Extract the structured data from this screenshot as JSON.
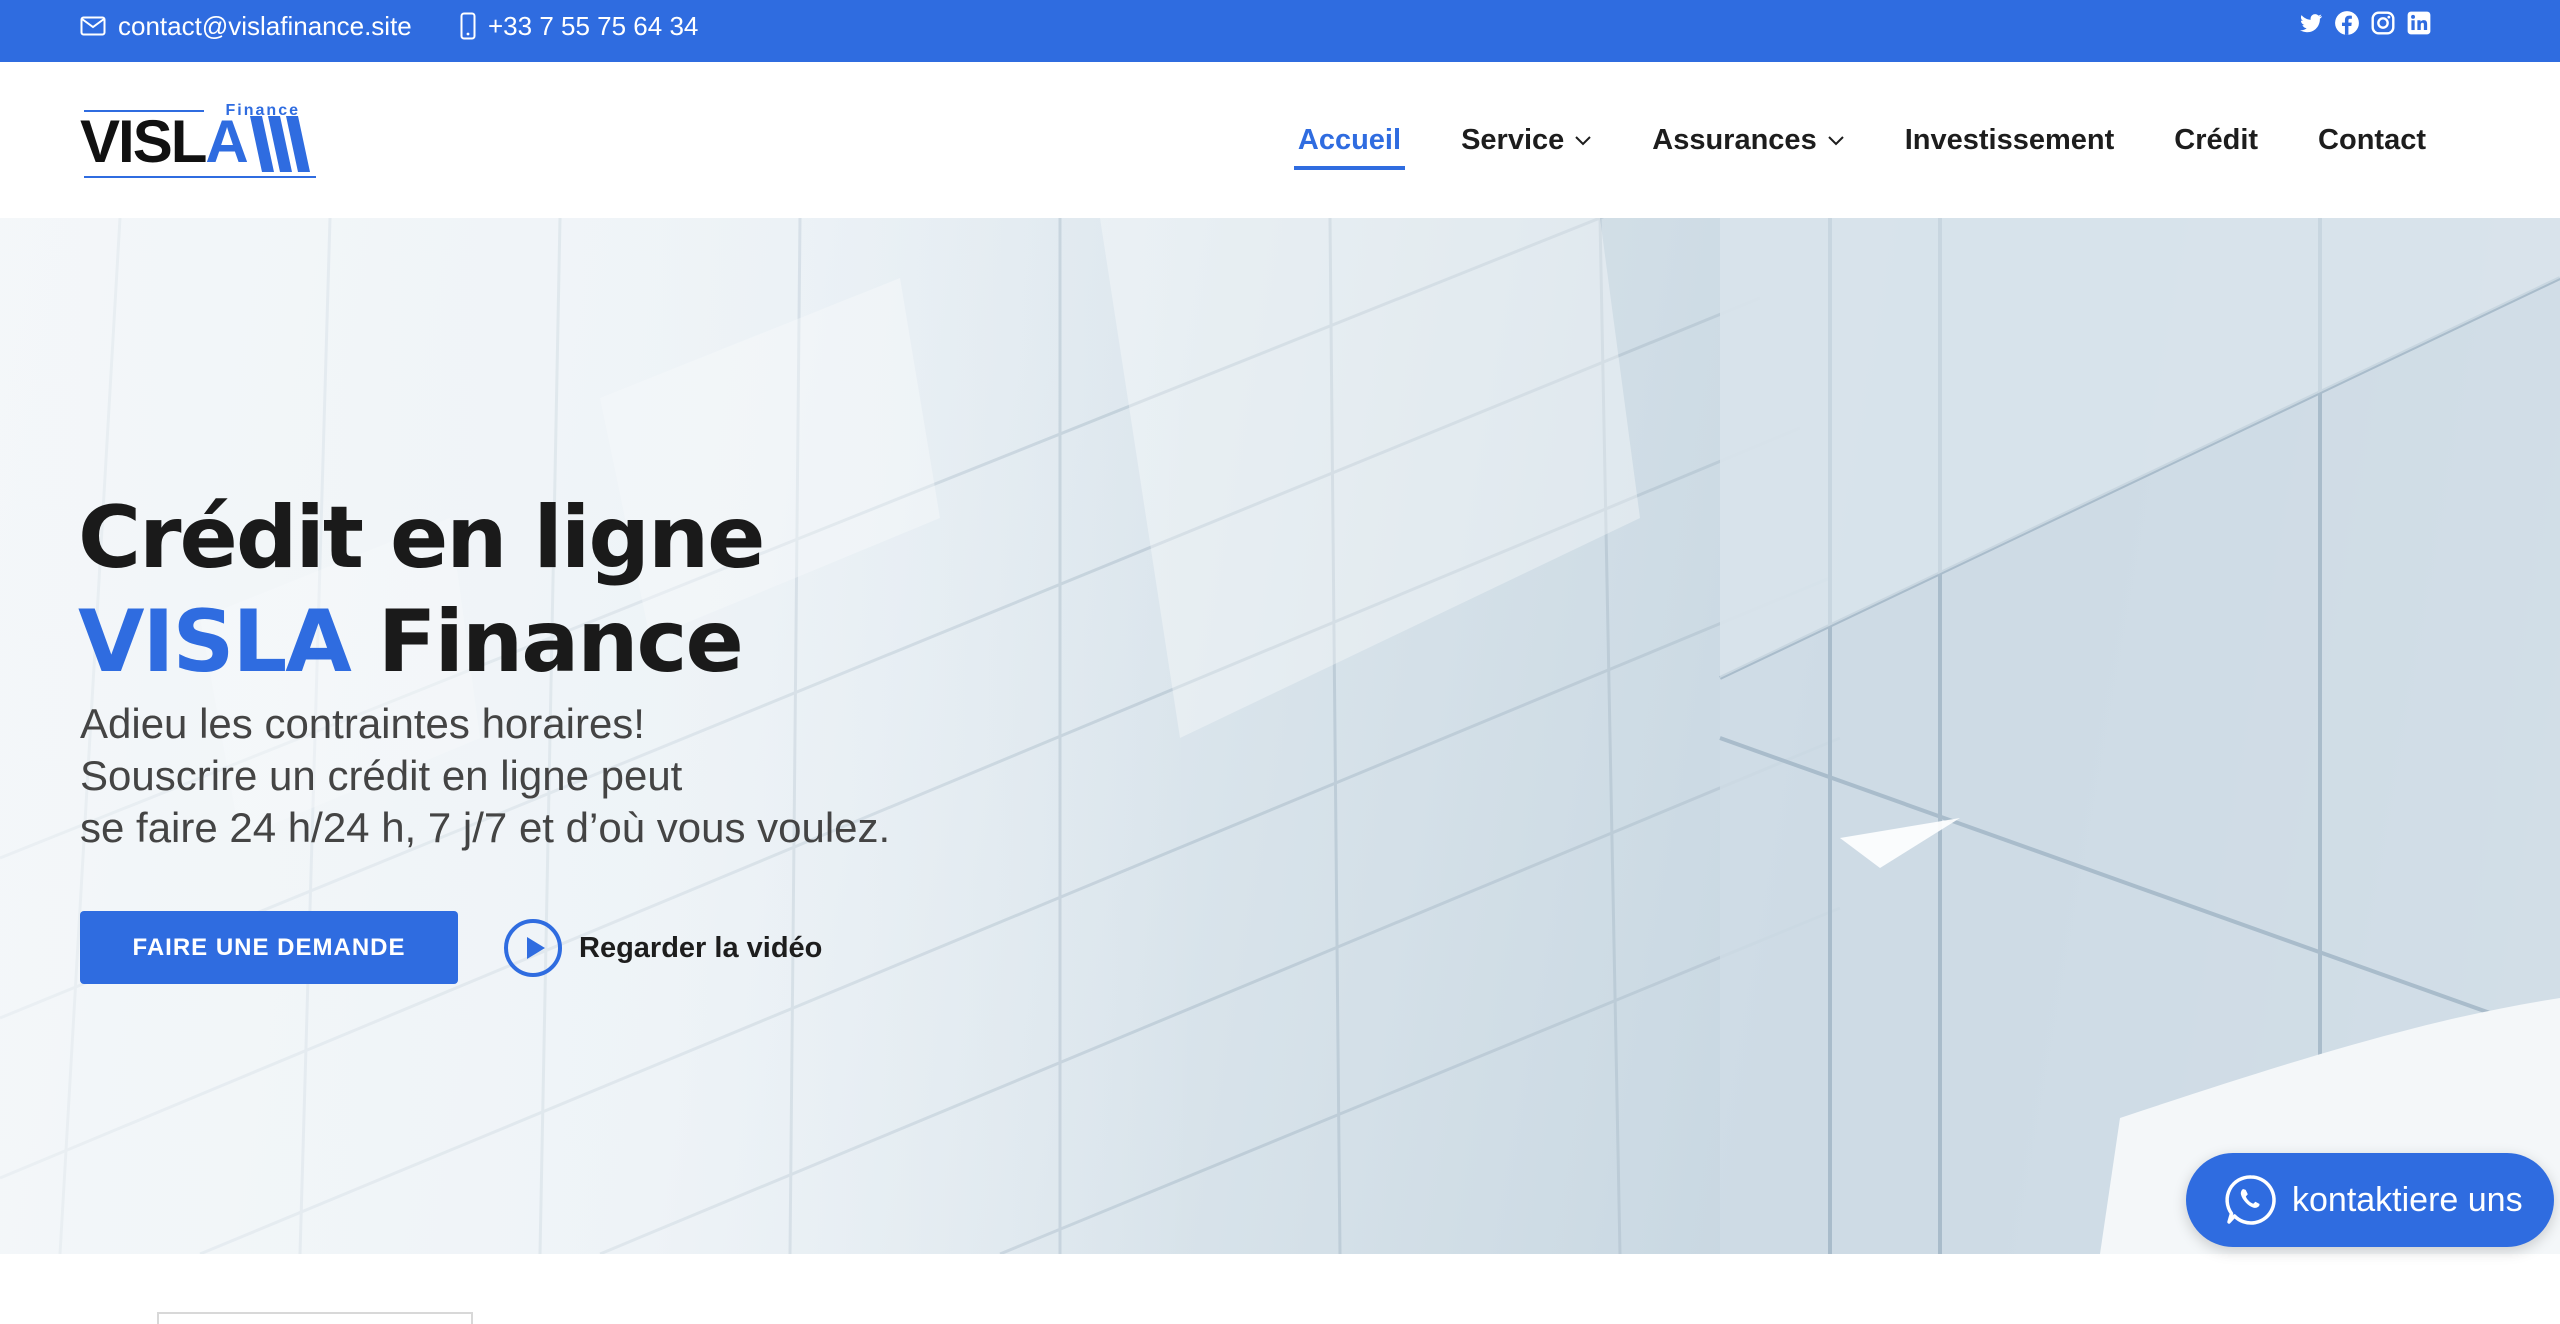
{
  "topbar": {
    "email": "contact@vislafinance.site",
    "phone": "+33 7 55 75 64 34",
    "socials": [
      "twitter-icon",
      "facebook-icon",
      "instagram-icon",
      "linkedin-icon"
    ]
  },
  "logo": {
    "brand": "VISLA",
    "brand_main": "VISL",
    "brand_accent": "A",
    "sub": "Finance"
  },
  "nav": {
    "items": [
      {
        "label": "Accueil",
        "active": true,
        "dropdown": false
      },
      {
        "label": "Service",
        "active": false,
        "dropdown": true
      },
      {
        "label": "Assurances",
        "active": false,
        "dropdown": true
      },
      {
        "label": "Investissement",
        "active": false,
        "dropdown": false
      },
      {
        "label": "Crédit",
        "active": false,
        "dropdown": false
      },
      {
        "label": "Contact",
        "active": false,
        "dropdown": false
      }
    ]
  },
  "hero": {
    "title_line1": "Crédit en ligne",
    "title_accent": "VISLA",
    "title_rest": " Finance",
    "subtitle_lines": [
      "Adieu les contraintes horaires!",
      "Souscrire un crédit en ligne peut",
      "se faire 24 h/24 h, 7 j/7 et d’où vous voulez."
    ],
    "cta_label": "FAIRE UNE DEMANDE",
    "video_label": "Regarder la vidéo"
  },
  "whatsapp": {
    "label": "kontaktiere uns",
    "icon": "whatsapp-icon"
  },
  "colors": {
    "primary": "#2f6ce0",
    "text_dark": "#1a1a1a",
    "text_muted": "#444444"
  }
}
